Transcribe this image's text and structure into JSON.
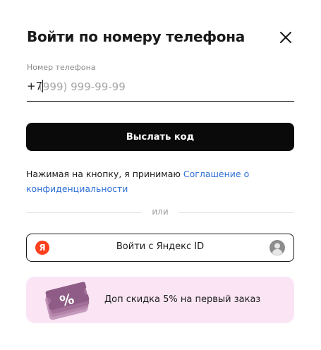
{
  "dialog": {
    "title": "Войти по номеру телефона",
    "close_icon": "close-icon"
  },
  "phone": {
    "label": "Номер телефона",
    "prefix": "+7",
    "placeholder": "(999) 999-99-99",
    "value": ""
  },
  "send_button": {
    "label": "Выслать код"
  },
  "agreement": {
    "text": "Нажимая на кнопку, я принимаю ",
    "link": "Соглашение о конфиденциальности"
  },
  "divider": {
    "text": "или"
  },
  "yandex": {
    "logo_letter": "Я",
    "label": "Войти с Яндекс ID",
    "logo_icon": "yandex-logo-icon",
    "avatar_icon": "user-avatar-icon"
  },
  "promo": {
    "text": "Доп скидка 5% на первый заказ",
    "image_icon": "discount-percent-tickets-icon",
    "image_glyph": "%"
  },
  "colors": {
    "primary_button": "#0a0a0a",
    "link": "#2f6fd6",
    "yandex_red": "#fc3f1d",
    "promo_bg": "#fbe5f4",
    "promo_ticket": "#b78ab0"
  }
}
